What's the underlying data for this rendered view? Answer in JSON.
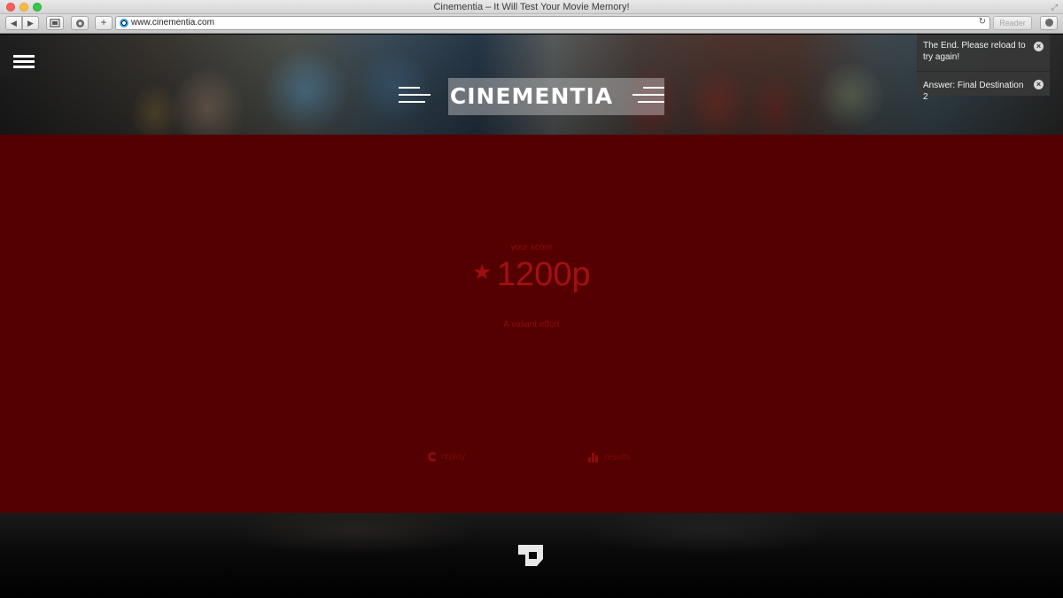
{
  "browser": {
    "window_title": "Cinementia – It Will Test Your Movie Memory!",
    "url": "www.cinementia.com",
    "reader_label": "Reader",
    "back_glyph": "◀",
    "forward_glyph": "▶",
    "plus_glyph": "+",
    "reload_glyph": "↻"
  },
  "site": {
    "logo_text": "CINEMENTIA"
  },
  "notifications": [
    {
      "text": "The End. Please reload to try again!"
    },
    {
      "text": "Answer: Final Destination 2"
    }
  ],
  "score": {
    "label": "your score",
    "value": "1200p",
    "verdict": "A valiant effort"
  },
  "actions": {
    "replay_label": "replay",
    "results_label": "results"
  },
  "icons": {
    "menu": "hamburger-menu-icon",
    "star": "star-icon",
    "replay": "replay-icon",
    "results": "bar-chart-icon",
    "close": "close-circle-icon",
    "footer_logo": "site-footer-logo"
  },
  "colors": {
    "panel_bg": "#540000",
    "score_text": "#a31010",
    "toast_bg": "#373737"
  }
}
